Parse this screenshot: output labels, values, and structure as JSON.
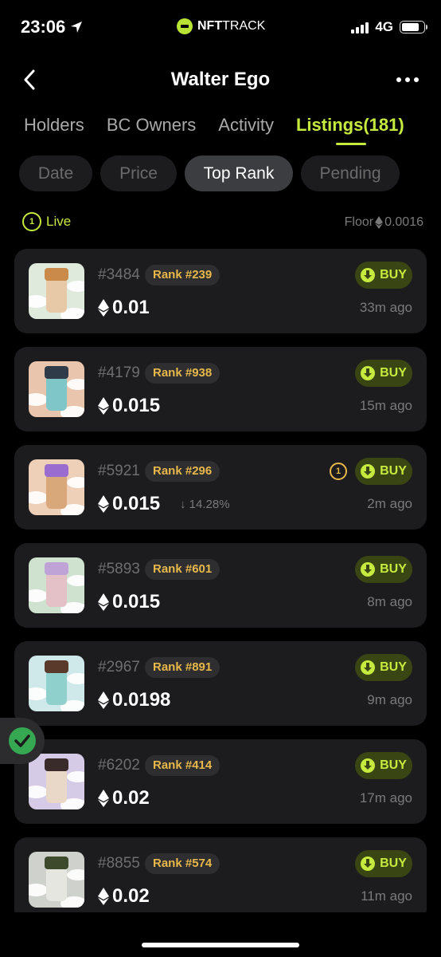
{
  "status_bar": {
    "time": "23:06",
    "carrier_logo_bold": "NFT",
    "carrier_logo_rest": "TRACK",
    "network": "4G"
  },
  "header": {
    "title": "Walter Ego"
  },
  "tabs": [
    {
      "label": "Holders",
      "active": false
    },
    {
      "label": "BC Owners",
      "active": false
    },
    {
      "label": "Activity",
      "active": false
    },
    {
      "label": "Listings(181)",
      "active": true
    }
  ],
  "sort_options": [
    {
      "label": "Date",
      "active": false
    },
    {
      "label": "Price",
      "active": false
    },
    {
      "label": "Top Rank",
      "active": true
    },
    {
      "label": "Pending",
      "active": false
    }
  ],
  "live": {
    "badge": "1",
    "label": "Live"
  },
  "floor": {
    "label": "Floor",
    "value": "0.0016"
  },
  "buy_label": "BUY",
  "listings": [
    {
      "token_id": "#3484",
      "rank": "Rank #239",
      "price": "0.01",
      "change": "",
      "time_ago": "33m ago",
      "pending": "",
      "bg": "#dfe9dc",
      "figure": "#e7c9a8",
      "hat": "#c98a4a"
    },
    {
      "token_id": "#4179",
      "rank": "Rank #938",
      "price": "0.015",
      "change": "",
      "time_ago": "15m ago",
      "pending": "",
      "bg": "#e9c5ae",
      "figure": "#7fc6c8",
      "hat": "#2f3b48"
    },
    {
      "token_id": "#5921",
      "rank": "Rank #296",
      "price": "0.015",
      "change": "↓ 14.28%",
      "time_ago": "2m ago",
      "pending": "1",
      "bg": "#eecfb7",
      "figure": "#d8a77a",
      "hat": "#9a6ccf"
    },
    {
      "token_id": "#5893",
      "rank": "Rank #601",
      "price": "0.015",
      "change": "",
      "time_ago": "8m ago",
      "pending": "",
      "bg": "#cfe2cf",
      "figure": "#e4c0c7",
      "hat": "#bfa3d6"
    },
    {
      "token_id": "#2967",
      "rank": "Rank #891",
      "price": "0.0198",
      "change": "",
      "time_ago": "9m ago",
      "pending": "",
      "bg": "#cfe8ea",
      "figure": "#8fd0cc",
      "hat": "#5a3a2a"
    },
    {
      "token_id": "#6202",
      "rank": "Rank #414",
      "price": "0.02",
      "change": "",
      "time_ago": "17m ago",
      "pending": "",
      "bg": "#d6cbe6",
      "figure": "#e9d7c7",
      "hat": "#3a2b2b"
    },
    {
      "token_id": "#8855",
      "rank": "Rank #574",
      "price": "0.02",
      "change": "",
      "time_ago": "11m ago",
      "pending": "",
      "bg": "#cfd1cc",
      "figure": "#e6e6e0",
      "hat": "#3d4a2c"
    }
  ],
  "colors": {
    "accent": "#c6ea3e",
    "rank_text": "#e8b84a",
    "card_bg": "#1c1c1e",
    "background": "#000000",
    "success": "#36a852"
  },
  "icons": {
    "back": "chevron-left-icon",
    "more": "more-horizontal-icon",
    "location": "location-arrow-icon",
    "eth": "ethereum-icon",
    "buy": "download-circle-icon",
    "check": "check-circle-icon"
  }
}
